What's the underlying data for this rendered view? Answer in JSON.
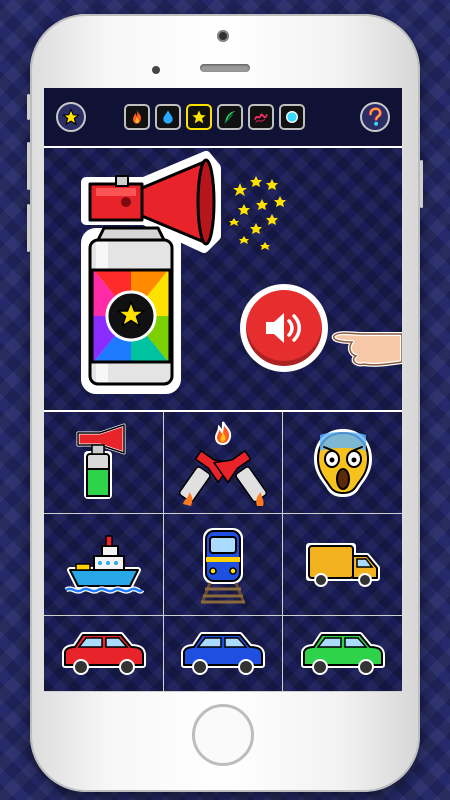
{
  "topbar": {
    "favorites_icon": "star-icon",
    "help_icon": "question-icon",
    "categories": [
      {
        "id": "fire",
        "icon": "fire-icon",
        "active": false
      },
      {
        "id": "water",
        "icon": "drop-icon",
        "active": false
      },
      {
        "id": "star",
        "icon": "star-icon",
        "active": true
      },
      {
        "id": "feather",
        "icon": "feather-icon",
        "active": false
      },
      {
        "id": "scribble",
        "icon": "scribble-icon",
        "active": false
      },
      {
        "id": "bubble",
        "icon": "bubble-icon",
        "active": false
      }
    ]
  },
  "hero": {
    "main_item": "air-horn",
    "play_button_icon": "speaker-icon",
    "accent_color": "#e62e2e"
  },
  "sounds": [
    {
      "id": "green-air-horn",
      "icon": "green-air-horn-icon"
    },
    {
      "id": "double-air-horn",
      "icon": "double-air-horn-fire-icon"
    },
    {
      "id": "scream-emoji",
      "icon": "screaming-face-icon"
    },
    {
      "id": "ship",
      "icon": "ship-icon"
    },
    {
      "id": "train",
      "icon": "train-icon"
    },
    {
      "id": "truck",
      "icon": "truck-icon"
    },
    {
      "id": "red-car",
      "icon": "red-car-icon",
      "color": "#e8232a"
    },
    {
      "id": "blue-car",
      "icon": "blue-car-icon",
      "color": "#1e4fe0"
    },
    {
      "id": "green-car",
      "icon": "green-car-icon",
      "color": "#2fd34a"
    }
  ]
}
